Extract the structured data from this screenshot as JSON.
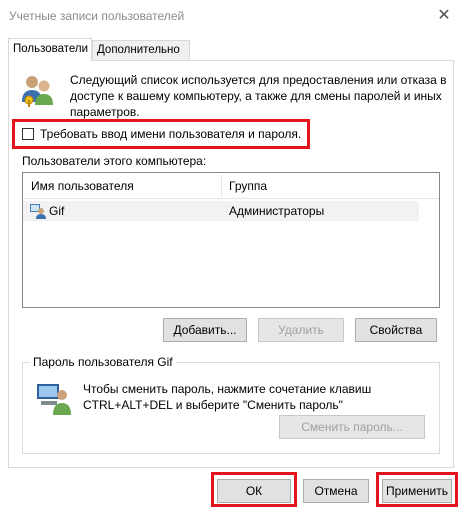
{
  "window": {
    "title": "Учетные записи пользователей",
    "close_glyph": "✕"
  },
  "tabs": [
    {
      "label": "Пользователи",
      "active": true
    },
    {
      "label": "Дополнительно",
      "active": false
    }
  ],
  "info": {
    "icon": "users-icon",
    "text": "Следующий список используется для предоставления или отказа в доступе к вашему компьютеру, а также для смены паролей и иных параметров."
  },
  "require_login": {
    "checked": false,
    "label": "Требовать ввод имени пользователя и пароля."
  },
  "users_section": {
    "label": "Пользователи этого компьютера:",
    "columns": [
      "Имя пользователя",
      "Группа"
    ],
    "rows": [
      {
        "name": "Gif",
        "group": "Администраторы",
        "icon": "user-icon"
      }
    ]
  },
  "user_buttons": {
    "add": "Добавить...",
    "remove": "Удалить",
    "properties": "Свойства"
  },
  "password_group": {
    "title": "Пароль пользователя Gif",
    "icon": "keyboard-user-icon",
    "line1": "Чтобы сменить пароль, нажмите сочетание клавиш",
    "line2": "CTRL+ALT+DEL и выберите \"Сменить пароль\"",
    "button": "Сменить пароль..."
  },
  "footer": {
    "ok": "ОК",
    "cancel": "Отмена",
    "apply": "Применить"
  },
  "colors": {
    "highlight": "#e3141b",
    "button_face": "#e1e1e1",
    "disabled_text": "#a0a0a0"
  }
}
